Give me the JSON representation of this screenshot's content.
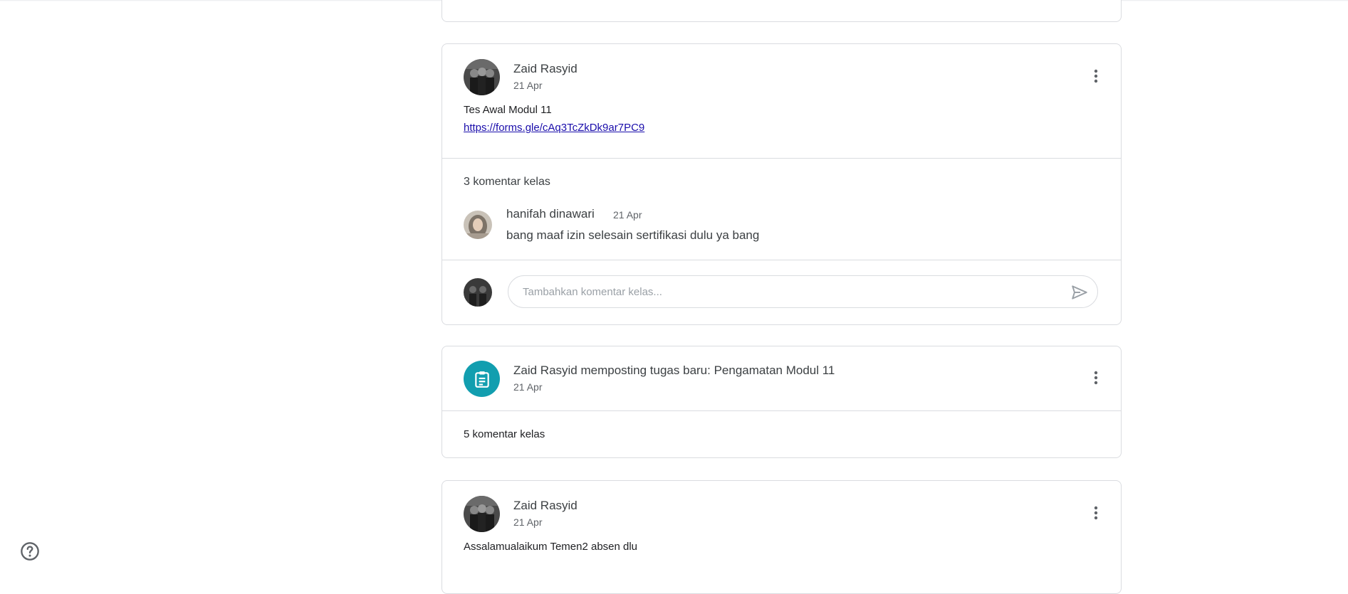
{
  "posts": [
    {
      "author": "Zaid Rasyid",
      "date": "21 Apr",
      "text": "Tes Awal Modul 11",
      "link": "https://forms.gle/cAq3TcZkDk9ar7PC9",
      "comments_count": "3 komentar kelas",
      "comment": {
        "author": "hanifah dinawari",
        "date": "21 Apr",
        "text": "bang maaf izin selesain sertifikasi dulu ya bang"
      },
      "comment_placeholder": "Tambahkan komentar kelas..."
    },
    {
      "title": "Zaid Rasyid memposting tugas baru: Pengamatan Modul 11",
      "date": "21 Apr",
      "comments_count": "5 komentar kelas",
      "icon": "assignment-icon",
      "accent": "#129eaf"
    },
    {
      "author": "Zaid Rasyid",
      "date": "21 Apr",
      "text": "Assalamualaikum Temen2 absen dlu"
    }
  ]
}
